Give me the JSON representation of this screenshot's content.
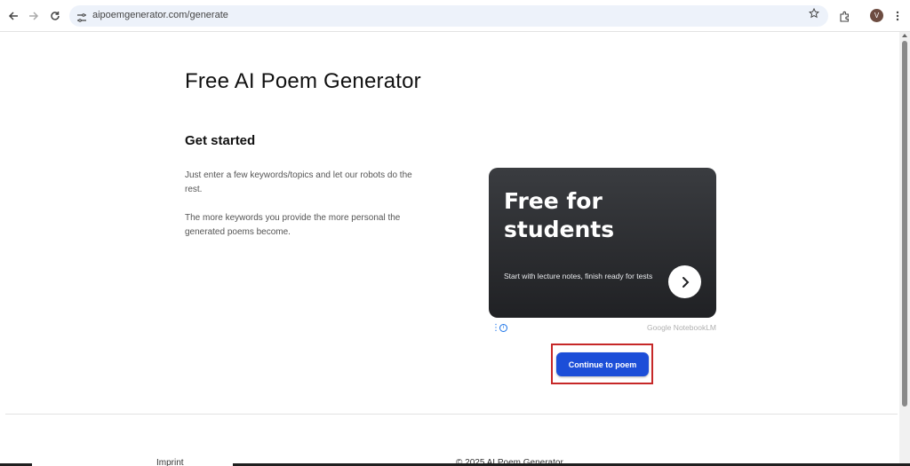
{
  "browser": {
    "url": "aipoemgenerator.com/generate",
    "avatar_initial": "V",
    "icons": {
      "back": "back-arrow-icon",
      "forward": "forward-arrow-icon",
      "reload": "reload-icon",
      "site_info": "tune-icon",
      "bookmark": "star-icon",
      "extensions": "puzzle-icon",
      "menu": "kebab-menu-icon"
    }
  },
  "page": {
    "title": "Free AI Poem Generator",
    "section_title": "Get started",
    "paragraph_1": "Just enter a few keywords/topics and let our robots do the rest.",
    "paragraph_2": "The more keywords you provide the more personal the generated poems become."
  },
  "ad": {
    "headline": "Free for students",
    "subtext": "Start with lecture notes, finish ready for tests",
    "brand": "Google NotebookLM",
    "colors": {
      "card_top": "#3a3c40",
      "card_bottom": "#202124",
      "ad_choice": "#1a73e8"
    }
  },
  "actions": {
    "continue_label": "Continue to poem",
    "colors": {
      "button": "#1c4ed8",
      "highlight_border": "#c62828"
    }
  },
  "footer": {
    "left": "Imprint",
    "center": "© 2025 AI Poem Generator"
  }
}
